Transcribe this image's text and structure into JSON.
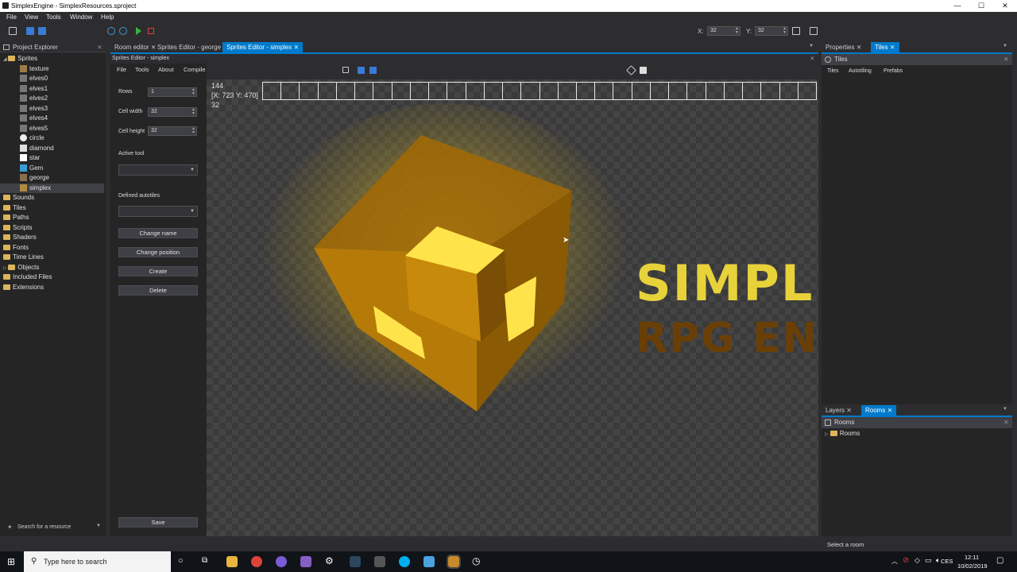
{
  "window": {
    "title": "SimplexEngine - SimplexResources.sproject"
  },
  "menubar": [
    "File",
    "View",
    "Tools",
    "Window",
    "Help"
  ],
  "toolbar": {
    "x_label": "X:",
    "x_value": "32",
    "y_label": "Y:",
    "y_value": "32"
  },
  "doc_tabs": [
    {
      "label": "Room editor",
      "active": false
    },
    {
      "label": "Sprites Editor - george",
      "active": false
    },
    {
      "label": "Sprites Editor - simplex",
      "active": true
    }
  ],
  "project_explorer": {
    "title": "Project Explorer",
    "items": [
      {
        "label": "Sprites",
        "kind": "folder",
        "level": 0
      },
      {
        "label": "texture",
        "kind": "sprite",
        "level": 1
      },
      {
        "label": "elves0",
        "kind": "sprite",
        "level": 1
      },
      {
        "label": "elves1",
        "kind": "sprite",
        "level": 1
      },
      {
        "label": "elves2",
        "kind": "sprite",
        "level": 1
      },
      {
        "label": "elves3",
        "kind": "sprite",
        "level": 1
      },
      {
        "label": "elves4",
        "kind": "sprite",
        "level": 1
      },
      {
        "label": "elves5",
        "kind": "sprite",
        "level": 1
      },
      {
        "label": "circle",
        "kind": "sprite",
        "level": 1
      },
      {
        "label": "diamond",
        "kind": "sprite",
        "level": 1
      },
      {
        "label": "star",
        "kind": "sprite",
        "level": 1
      },
      {
        "label": "Gem",
        "kind": "sprite",
        "level": 1
      },
      {
        "label": "george",
        "kind": "sprite",
        "level": 1
      },
      {
        "label": "simplex",
        "kind": "sprite",
        "level": 1,
        "selected": true
      },
      {
        "label": "Sounds",
        "kind": "folder",
        "level": 0
      },
      {
        "label": "Tiles",
        "kind": "folder",
        "level": 0
      },
      {
        "label": "Paths",
        "kind": "folder",
        "level": 0
      },
      {
        "label": "Scripts",
        "kind": "folder",
        "level": 0
      },
      {
        "label": "Shaders",
        "kind": "folder",
        "level": 0
      },
      {
        "label": "Fonts",
        "kind": "folder",
        "level": 0
      },
      {
        "label": "Time Lines",
        "kind": "folder",
        "level": 0
      },
      {
        "label": "Objects",
        "kind": "folder",
        "level": 0
      },
      {
        "label": "Included Files",
        "kind": "folder",
        "level": 0
      },
      {
        "label": "Extensions",
        "kind": "folder",
        "level": 0
      }
    ],
    "search_placeholder": "Search for a resource"
  },
  "sprite_editor": {
    "title": "Sprites Editor - simplex",
    "menu": [
      "File",
      "Tools",
      "About",
      "Compile"
    ],
    "rows_label": "Rows",
    "rows_value": "1",
    "cell_width_label": "Cell width",
    "cell_width_value": "32",
    "cell_height_label": "Cell height",
    "cell_height_value": "32",
    "active_tool_label": "Active tool",
    "defined_autotiles_label": "Defined autotiles",
    "buttons": {
      "change_name": "Change name",
      "change_position": "Change position",
      "create": "Create",
      "delete": "Delete",
      "save": "Save"
    },
    "info_width": "144",
    "info_coords": "[X: 723 Y: 470]",
    "info_height": "32",
    "logo_line1": "SIMPLE",
    "logo_line2": "RPG EN"
  },
  "right_top": {
    "tabs": [
      {
        "label": "Properties",
        "active": false
      },
      {
        "label": "Tiles",
        "active": true
      }
    ],
    "header": "Tiles",
    "subtabs": [
      "Tiles",
      "Autotiling",
      "Prefabs"
    ]
  },
  "right_bottom": {
    "tabs": [
      {
        "label": "Layers",
        "active": false
      },
      {
        "label": "Rooms",
        "active": true
      }
    ],
    "header": "Rooms",
    "tree_item": "Rooms"
  },
  "status": {
    "text": "Select a room"
  },
  "taskbar": {
    "search_placeholder": "Type here to search",
    "lang": "CES",
    "time": "12:11",
    "date": "10/02/2019"
  },
  "colors": {
    "accent": "#007acc",
    "folder": "#dcb45a",
    "cube": "#c8900a"
  }
}
